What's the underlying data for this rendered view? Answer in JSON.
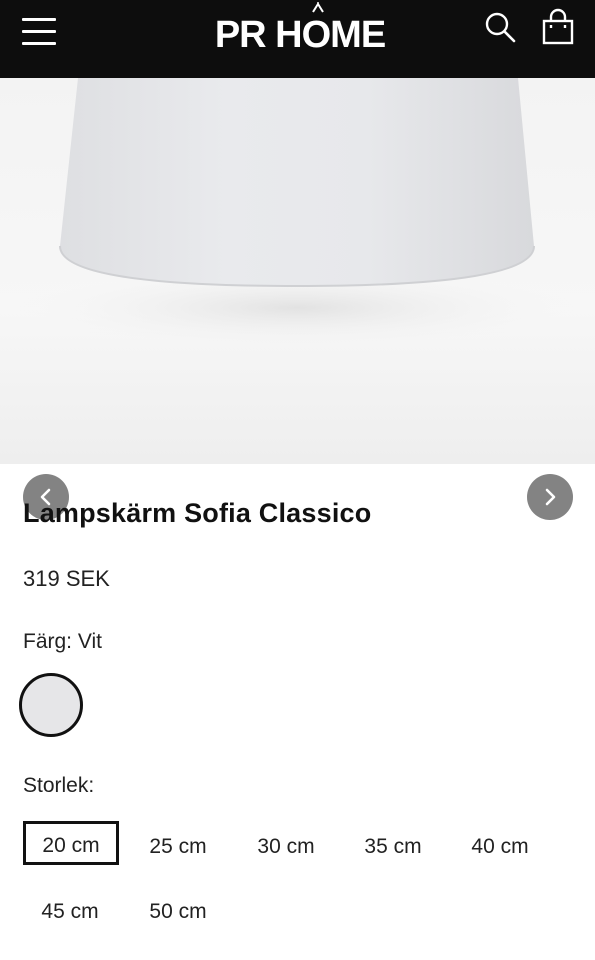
{
  "header": {
    "brand": "PR HOME",
    "menu_icon": "hamburger-menu-icon",
    "search_icon": "search-icon",
    "cart_icon": "shopping-bag-icon",
    "background": "#0d0d0d"
  },
  "gallery": {
    "prev_icon": "chevron-left-icon",
    "next_icon": "chevron-right-icon"
  },
  "product": {
    "title": "Lampskärm Sofia Classico",
    "price": "319 SEK",
    "color_label": "Färg: Vit",
    "color_swatch": "#e6e6e8",
    "size_label": "Storlek:",
    "sizes": [
      "20 cm",
      "25 cm",
      "30 cm",
      "35 cm",
      "40 cm",
      "45 cm",
      "50 cm"
    ],
    "selected_size": "20 cm"
  }
}
